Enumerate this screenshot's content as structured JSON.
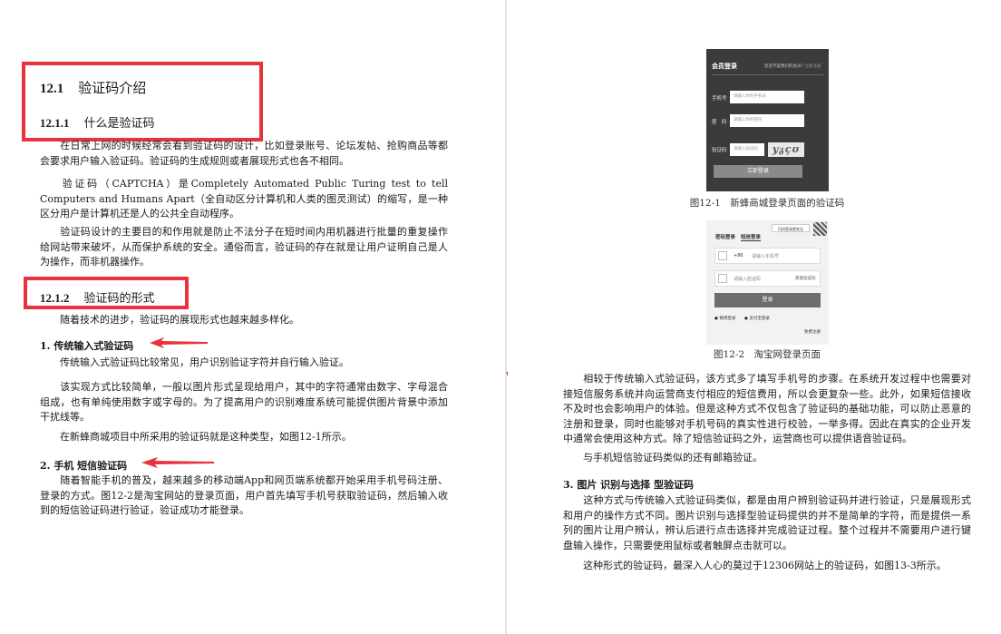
{
  "left": {
    "h1": {
      "num": "12.1",
      "title": "验证码介绍"
    },
    "h2a": {
      "num": "12.1.1",
      "title": "什么是验证码"
    },
    "p1": "在日常上网的时候经常会看到验证码的设计，比如登录账号、论坛发帖、抢购商品等都会要求用户输入验证码。验证码的生成规则或者展现形式也各不相同。",
    "p2": "验证码（CAPTCHA）是Completely Automated Public Turing test to tell Computers and Humans Apart（全自动区分计算机和人类的图灵测试）的缩写，是一种区分用户是计算机还是人的公共全自动程序。",
    "p3": "验证码设计的主要目的和作用就是防止不法分子在短时间内用机器进行批量的重复操作给网站带来破坏，从而保护系统的安全。通俗而言，验证码的存在就是让用户证明自己是人为操作，而非机器操作。",
    "h2b": {
      "num": "12.1.2",
      "title": "验证码的形式"
    },
    "p4": "随着技术的进步，验证码的展现形式也越来越多样化。",
    "h3a": "1. 传统输入式验证码",
    "p5": "传统输入式验证码比较常见，用户识别验证字符并自行输入验证。",
    "p6": "该实现方式比较简单，一般以图片形式呈现给用户，其中的字符通常由数字、字母混合组成，也有单纯使用数字或字母的。为了提高用户的识别难度系统可能提供图片背景中添加干扰线等。",
    "p7": "在新蜂商城项目中所采用的验证码就是这种类型，如图12-1所示。",
    "h3b": "2. 手机 短信验证码",
    "p8": "随着智能手机的普及，越来越多的移动端App和网页端系统都开始采用手机号码注册、登录的方式。图12-2是淘宝网站的登录页面，用户首先填写手机号获取验证码，然后输入收到的短信验证码进行验证，验证成功才能登录。"
  },
  "right": {
    "shot1": {
      "title": "会员登录",
      "aside": "您还不是我们的会员?",
      "aside_link": "立即注册",
      "phone_label": "手机号",
      "phone_ph": "请输入你的手机号",
      "pwd_label": "密　码",
      "pwd_ph": "请输入你的密码",
      "code_label": "验证码",
      "code_ph": "请输入验证码",
      "captcha": "yᵹçʊ",
      "login": "立即登录"
    },
    "caption1": "图12-1　新蜂商城登录页面的验证码",
    "shot2": {
      "badge": "扫码登录更安全",
      "tab_pwd": "密码登录",
      "tab_sms": "短信登录",
      "cc": "+86",
      "phone_ph": "请输入手机号",
      "code_ph": "请输入验证码",
      "get_code": "获取验证码",
      "login": "登录",
      "opt1": "微博登录",
      "opt2": "支付宝登录",
      "register": "免费注册"
    },
    "caption2": "图12-2　淘宝网登录页面",
    "p1": "相较于传统输入式验证码，该方式多了填写手机号的步骤。在系统开发过程中也需要对接短信服务系统并向运营商支付相应的短信费用，所以会更复杂一些。此外，如果短信接收不及时也会影响用户的体验。但是这种方式不仅包含了验证码的基础功能，可以防止恶意的注册和登录，同时也能够对手机号码的真实性进行校验，一举多得。因此在真实的企业开发中通常会使用这种方式。除了短信验证码之外，运营商也可以提供语音验证码。",
    "p2": "与手机短信验证码类似的还有邮箱验证。",
    "h3": "3. 图片 识别与选择 型验证码",
    "p3": "这种方式与传统输入式验证码类似，都是由用户辨别验证码并进行验证，只是展现形式和用户的操作方式不同。图片识别与选择型验证码提供的并不是简单的字符，而是提供一系列的图片让用户辨认，辨认后进行点击选择并完成验证过程。整个过程并不需要用户进行键盘输入操作，只需要使用鼠标或者触屏点击就可以。",
    "p4": "这种形式的验证码，最深入人心的莫过于12306网站上的验证码，如图13-3所示。"
  },
  "colors": {
    "highlight": "#e8323c",
    "shot_dark": "#3b3b3b"
  }
}
